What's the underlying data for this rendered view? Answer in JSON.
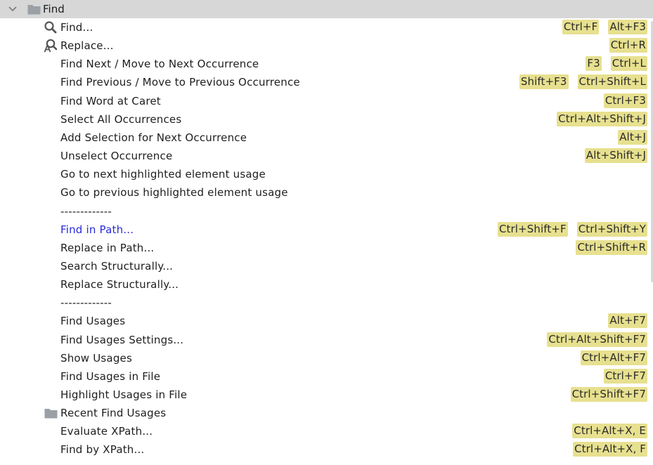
{
  "group": {
    "label": "Find",
    "expanded": true,
    "icon": "folder-icon"
  },
  "items": [
    {
      "label": "Find...",
      "icon": "search-icon",
      "shortcuts": [
        "Ctrl+F",
        "Alt+F3"
      ]
    },
    {
      "label": "Replace...",
      "icon": "replace-icon",
      "shortcuts": [
        "Ctrl+R"
      ]
    },
    {
      "label": "Find Next / Move to Next Occurrence",
      "shortcuts": [
        "F3",
        "Ctrl+L"
      ]
    },
    {
      "label": "Find Previous / Move to Previous Occurrence",
      "shortcuts": [
        "Shift+F3",
        "Ctrl+Shift+L"
      ]
    },
    {
      "label": "Find Word at Caret",
      "shortcuts": [
        "Ctrl+F3"
      ]
    },
    {
      "label": "Select All Occurrences",
      "shortcuts": [
        "Ctrl+Alt+Shift+J"
      ]
    },
    {
      "label": "Add Selection for Next Occurrence",
      "shortcuts": [
        "Alt+J"
      ]
    },
    {
      "label": "Unselect Occurrence",
      "shortcuts": [
        "Alt+Shift+J"
      ]
    },
    {
      "label": "Go to next highlighted element usage",
      "shortcuts": []
    },
    {
      "label": "Go to previous highlighted element usage",
      "shortcuts": []
    },
    {
      "label": "-------------",
      "shortcuts": []
    },
    {
      "label": "Find in Path...",
      "link": true,
      "shortcuts": [
        "Ctrl+Shift+F",
        "Ctrl+Shift+Y"
      ]
    },
    {
      "label": "Replace in Path...",
      "shortcuts": [
        "Ctrl+Shift+R"
      ]
    },
    {
      "label": "Search Structurally...",
      "shortcuts": []
    },
    {
      "label": "Replace Structurally...",
      "shortcuts": []
    },
    {
      "label": "-------------",
      "shortcuts": []
    },
    {
      "label": "Find Usages",
      "shortcuts": [
        "Alt+F7"
      ]
    },
    {
      "label": "Find Usages Settings...",
      "shortcuts": [
        "Ctrl+Alt+Shift+F7"
      ]
    },
    {
      "label": "Show Usages",
      "shortcuts": [
        "Ctrl+Alt+F7"
      ]
    },
    {
      "label": "Find Usages in File",
      "shortcuts": [
        "Ctrl+F7"
      ]
    },
    {
      "label": "Highlight Usages in File",
      "shortcuts": [
        "Ctrl+Shift+F7"
      ]
    },
    {
      "label": "Recent Find Usages",
      "icon": "folder-icon",
      "shortcuts": []
    },
    {
      "label": "Evaluate XPath...",
      "shortcuts": [
        "Ctrl+Alt+X, E"
      ]
    },
    {
      "label": "Find by XPath...",
      "shortcuts": [
        "Ctrl+Alt+X, F"
      ]
    }
  ],
  "colors": {
    "group_bg": "#d7d7d7",
    "shortcut_bg": "#e7e08f",
    "link": "#2a2ad8",
    "folder": "#9aa0a6"
  }
}
